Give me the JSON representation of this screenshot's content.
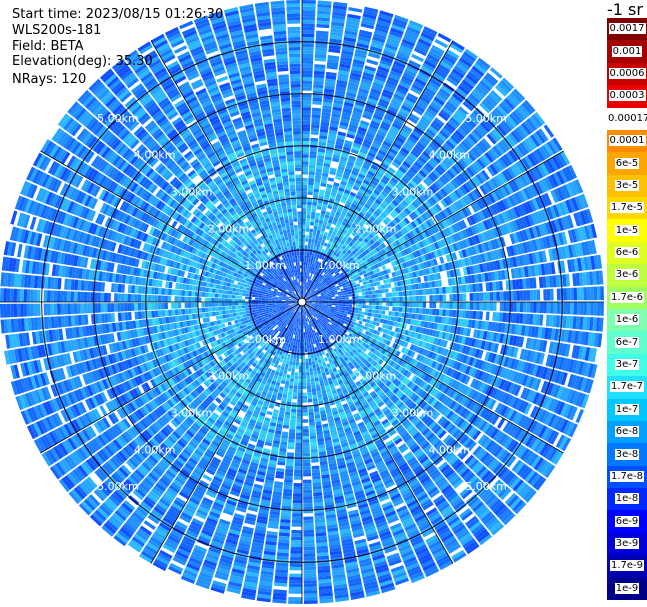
{
  "header": {
    "start_time": "Start time: 2023/08/15 01:26:30",
    "instrument": "WLS200s-181",
    "field": "Field: BETA",
    "elevation": "Elevation(deg): 35.30",
    "nrays": "NRays: 120"
  },
  "colorbar": {
    "units_label": "-1 sr",
    "ticks": [
      "0.0017",
      "0.001",
      "0.0006",
      "0.0003",
      "0.00017",
      "0.0001",
      "6e-5",
      "3e-5",
      "1.7e-5",
      "1e-5",
      "6e-6",
      "3e-6",
      "1.7e-6",
      "1e-6",
      "6e-7",
      "3e-7",
      "1.7e-7",
      "1e-7",
      "6e-8",
      "3e-8",
      "1.7e-8",
      "1e-8",
      "6e-9",
      "3e-9",
      "1.7e-9",
      "1e-9"
    ],
    "colors": [
      "#800000",
      "#a50000",
      "#c80000",
      "#eb0000",
      "#ffffff",
      "#ff8c00",
      "#ffa500",
      "#ffc000",
      "#ffd800",
      "#ffff00",
      "#e0ff20",
      "#c0ff40",
      "#a0ff60",
      "#7fffb0",
      "#60ffd0",
      "#40ffe8",
      "#20e0ff",
      "#00c8ff",
      "#00a0ff",
      "#0078ff",
      "#0050ff",
      "#0028ff",
      "#0000ff",
      "#0000d8",
      "#0000b0",
      "#000088"
    ]
  },
  "chart_data": {
    "type": "heatmap",
    "projection": "polar PPI scan",
    "rays": 120,
    "field": "BETA",
    "units": "-1 sr",
    "elevation_deg": 35.3,
    "range_rings_km": [
      1.0,
      2.0,
      3.0,
      4.0,
      5.0
    ],
    "range_labels": [
      "1.00km",
      "2.00km",
      "3.00km",
      "4.00km",
      "5.00km"
    ],
    "max_range_km": 5.8,
    "radial_lines": 12,
    "color_scale": "log",
    "value_range": [
      1e-09,
      0.0017
    ],
    "typical_values": {
      "near_center": 1e-08,
      "mid_range": 1.7e-07,
      "far_range": 3e-08
    }
  }
}
